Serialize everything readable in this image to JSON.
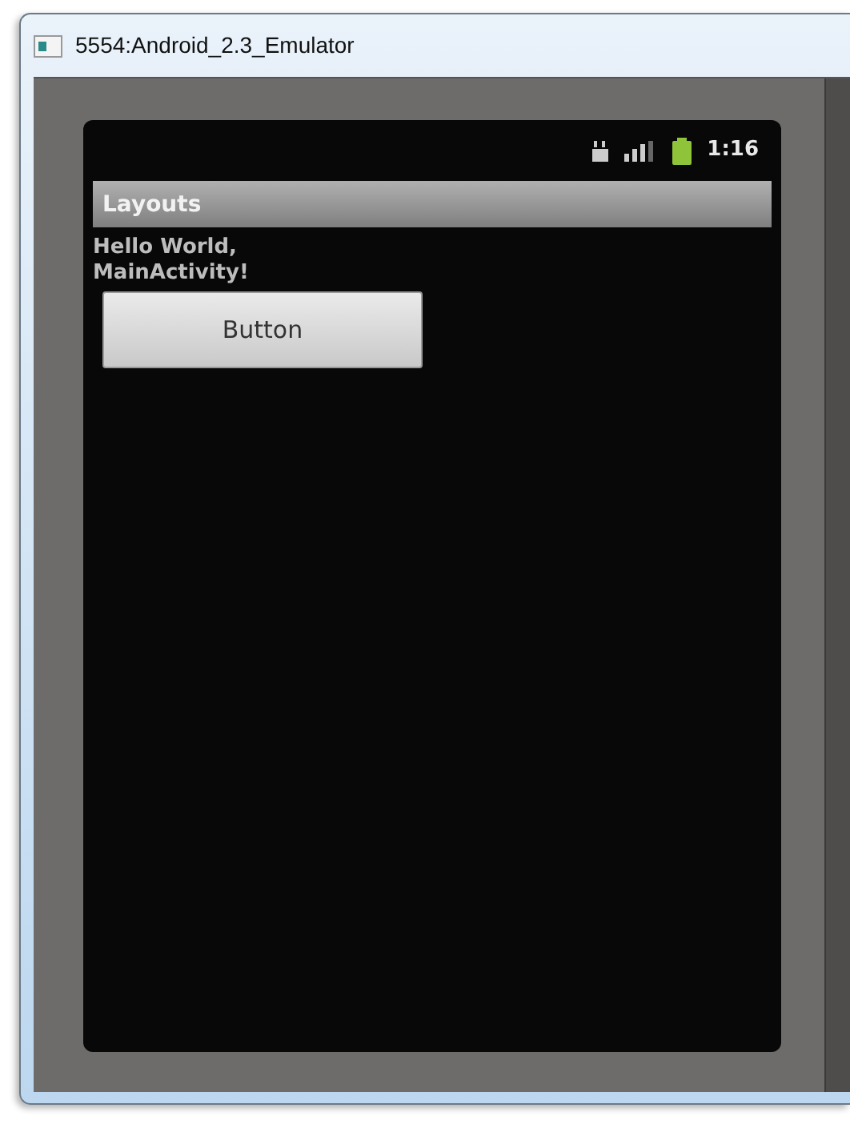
{
  "window": {
    "title": "5554:Android_2.3_Emulator"
  },
  "status_bar": {
    "time": "1:16"
  },
  "app_title": "Layouts",
  "message": "Hello World, MainActivity!",
  "button": {
    "label": "Button"
  }
}
